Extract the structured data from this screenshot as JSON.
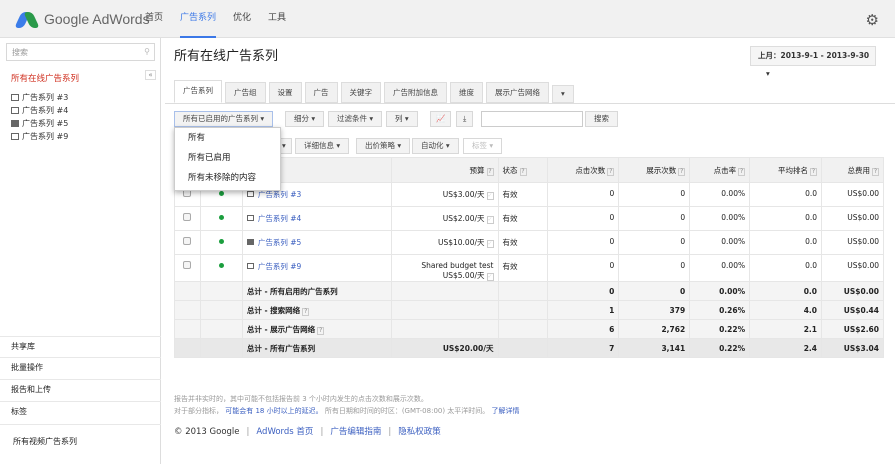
{
  "header": {
    "logo": "Google AdWords",
    "nav": [
      "首页",
      "广告系列",
      "优化",
      "工具"
    ],
    "active_nav": "广告系列"
  },
  "sidebar": {
    "search_placeholder": "搜索",
    "title": "所有在线广告系列",
    "campaigns": [
      "广告系列 #3",
      "广告系列 #4",
      "广告系列 #5",
      "广告系列 #9"
    ],
    "sections": [
      "共享库",
      "批量操作",
      "报告和上传",
      "标签",
      "所有视频广告系列"
    ]
  },
  "main": {
    "title": "所有在线广告系列",
    "date_range": "上月：2013-9-1 - 2013-9-30",
    "tabs": [
      "广告系列",
      "广告组",
      "设置",
      "广告",
      "关键字",
      "广告附加信息",
      "维度",
      "展示广告网络"
    ],
    "toolbar": {
      "filter": "所有已启用的广告系列",
      "segment": "细分",
      "filters": "过滤条件",
      "columns": "列",
      "search": "搜索",
      "details": "详细信息",
      "bid_strategy": "出价策略",
      "automate": "自动化",
      "labels": "标签"
    },
    "filter_options": [
      "所有",
      "所有已启用",
      "所有未移除的内容"
    ],
    "columns": [
      "预算",
      "状态",
      "点击次数",
      "展示次数",
      "点击率",
      "平均排名",
      "总费用"
    ],
    "rows": [
      {
        "name": "广告系列 #3",
        "budget_note": "",
        "budget": "US$3.00/天",
        "status": "有效",
        "clicks": "0",
        "impr": "0",
        "ctr": "0.00%",
        "pos": "0.0",
        "cost": "US$0.00"
      },
      {
        "name": "广告系列 #4",
        "budget_note": "",
        "budget": "US$2.00/天",
        "status": "有效",
        "clicks": "0",
        "impr": "0",
        "ctr": "0.00%",
        "pos": "0.0",
        "cost": "US$0.00"
      },
      {
        "name": "广告系列 #5",
        "budget_note": "",
        "budget": "US$10.00/天",
        "status": "有效",
        "clicks": "0",
        "impr": "0",
        "ctr": "0.00%",
        "pos": "0.0",
        "cost": "US$0.00"
      },
      {
        "name": "广告系列 #9",
        "budget_note": "Shared budget test",
        "budget": "US$5.00/天",
        "status": "有效",
        "clicks": "0",
        "impr": "0",
        "ctr": "0.00%",
        "pos": "0.0",
        "cost": "US$0.00"
      }
    ],
    "totals": [
      {
        "label": "总计 - 所有启用的广告系列",
        "budget": "",
        "clicks": "0",
        "impr": "0",
        "ctr": "0.00%",
        "pos": "0.0",
        "cost": "US$0.00"
      },
      {
        "label": "总计 - 搜索网络",
        "budget": "",
        "clicks": "1",
        "impr": "379",
        "ctr": "0.26%",
        "pos": "4.0",
        "cost": "US$0.44"
      },
      {
        "label": "总计 - 展示广告网络",
        "budget": "",
        "clicks": "6",
        "impr": "2,762",
        "ctr": "0.22%",
        "pos": "2.1",
        "cost": "US$2.60"
      },
      {
        "label": "总计 - 所有广告系列",
        "budget": "US$20.00/天",
        "clicks": "7",
        "impr": "3,141",
        "ctr": "0.22%",
        "pos": "2.4",
        "cost": "US$3.04"
      }
    ]
  },
  "footer": {
    "note1": "报告并非实时的，其中可能不包括报告前 3 个小时内发生的点击次数和展示次数。",
    "note2a": "对于部分指标，",
    "note2_link": "可能会有 18 小时以上的延迟。",
    "note2b": "所有日期和时间的时区：(GMT-08:00) 太平洋时间。",
    "learn_more": "了解详情",
    "copyright": "© 2013 Google",
    "links": [
      "AdWords 首页",
      "广告编辑指南",
      "隐私权政策"
    ]
  }
}
